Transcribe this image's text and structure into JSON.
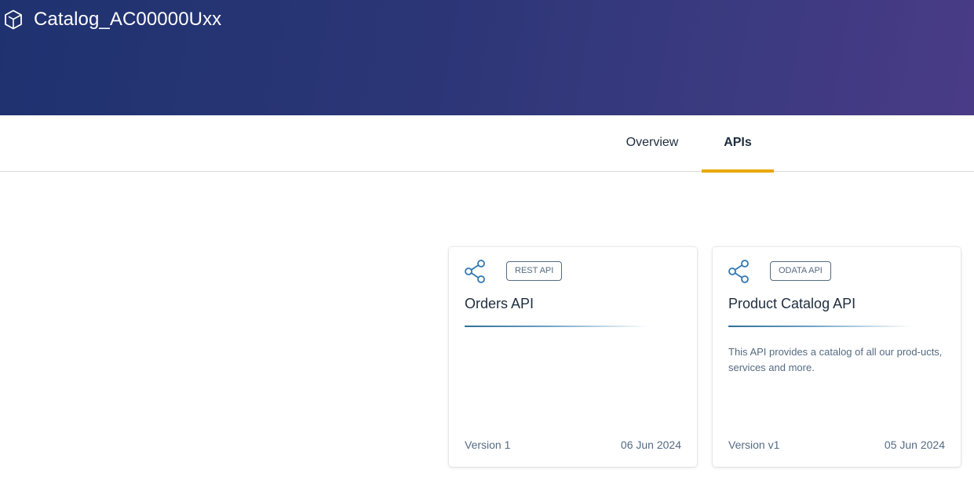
{
  "header": {
    "title": "Catalog_AC00000Uxx",
    "icon": "package-icon",
    "gradient_colors": [
      "#1f3270",
      "#4a3b87"
    ]
  },
  "tabs": [
    {
      "label": "Overview",
      "selected": false
    },
    {
      "label": "APIs",
      "selected": true
    }
  ],
  "accent_color": "#e9a800",
  "cards": [
    {
      "icon": "share-icon",
      "type_badge": "REST API",
      "title": "Orders API",
      "description": "",
      "version": "Version 1",
      "date": "06 Jun 2024"
    },
    {
      "icon": "share-icon",
      "type_badge": "ODATA API",
      "title": "Product Catalog API",
      "description": "This API provides a catalog of all our prod-ucts, services and more.",
      "version": "Version v1",
      "date": "05 Jun 2024"
    }
  ]
}
